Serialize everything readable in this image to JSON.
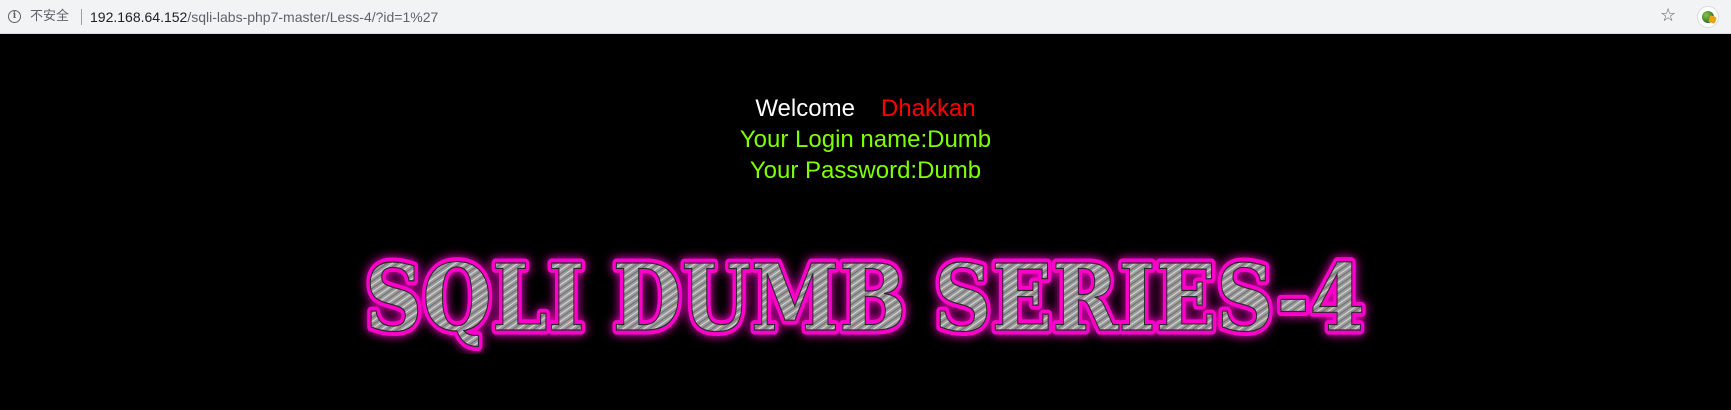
{
  "browser": {
    "security_label": "不安全",
    "url_host": "192.168.64.152",
    "url_path": "/sqli-labs-php7-master/Less-4/?id=1%27"
  },
  "page": {
    "welcome_word": "Welcome",
    "welcome_name": "Dhakkan",
    "login_text": "Your Login name:Dumb",
    "password_text": "Your Password:Dumb",
    "banner_text": "SQLI DUMB SERIES-4"
  },
  "colors": {
    "background": "#000000",
    "welcome": "#ffffff",
    "name": "#ff0000",
    "result_text": "#7fff00",
    "banner_glow": "#ff00cc",
    "banner_fill": "#a0a0a0"
  },
  "icons": {
    "info": "info-icon",
    "star": "star-icon",
    "extension": "extension-icon"
  }
}
